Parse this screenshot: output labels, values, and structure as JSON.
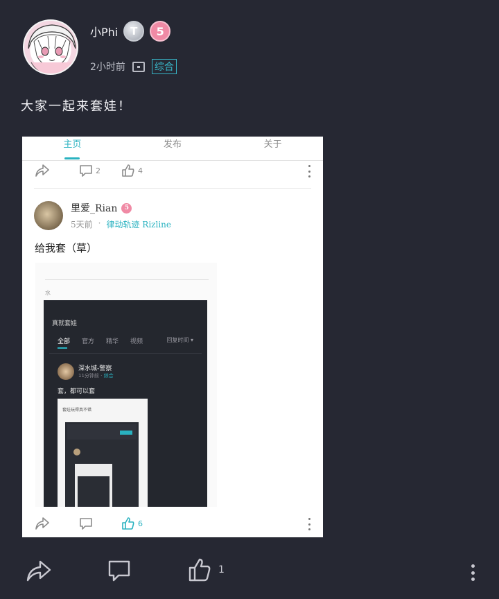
{
  "post": {
    "author": "小Phi",
    "badge_letter": "T",
    "level": "5",
    "time": "2小时前",
    "category": "综合",
    "title": "大家一起来套娃！"
  },
  "embedded": {
    "tabs": [
      "主页",
      "发布",
      "关于"
    ],
    "prev_comments": "2",
    "prev_likes": "4",
    "user": "里爱_Rian",
    "user_level": "5",
    "time": "5天前",
    "dot": "·",
    "category": "律动轨迹 Rizline",
    "text": "给我套（草）",
    "likes": "6",
    "nested": {
      "mini_text": "水",
      "section_title": "真就套娃",
      "tabs": [
        "全部",
        "官方",
        "精华",
        "视频"
      ],
      "sort": "回复时间 ▾",
      "user": "深水城-警察",
      "time": "11分钟前 · ",
      "category": "综合",
      "text": "套，都可以套",
      "card_title": "套娃玩得真不错"
    }
  },
  "actions": {
    "likes": "1"
  },
  "colors": {
    "background": "#262833",
    "accent": "#29b2c0",
    "level_badge": "#f08aa5"
  }
}
